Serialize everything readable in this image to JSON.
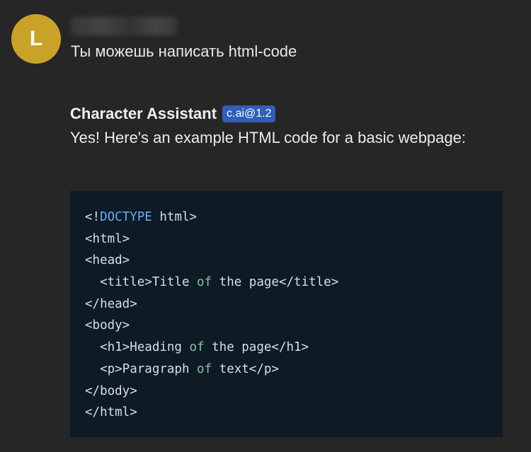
{
  "user_message": {
    "avatar_letter": "L",
    "text": "Ты можешь написать html-code"
  },
  "assistant_message": {
    "name": "Character Assistant",
    "badge": "c.ai@1.2",
    "text": "Yes! Here's an example HTML code for a basic webpage:"
  },
  "code_block": {
    "lines": [
      {
        "indent": "",
        "parts": [
          {
            "t": "<!",
            "c": "tag"
          },
          {
            "t": "DOCTYPE",
            "c": "kw"
          },
          {
            "t": " html>",
            "c": "tag"
          }
        ]
      },
      {
        "indent": "",
        "parts": [
          {
            "t": "<html>",
            "c": "tag"
          }
        ]
      },
      {
        "indent": "",
        "parts": [
          {
            "t": "<head>",
            "c": "tag"
          }
        ]
      },
      {
        "indent": "  ",
        "parts": [
          {
            "t": "<title>Title ",
            "c": "tag"
          },
          {
            "t": "of",
            "c": "word"
          },
          {
            "t": " the page</title>",
            "c": "tag"
          }
        ]
      },
      {
        "indent": "",
        "parts": [
          {
            "t": "</head>",
            "c": "tag"
          }
        ]
      },
      {
        "indent": "",
        "parts": [
          {
            "t": "<body>",
            "c": "tag"
          }
        ]
      },
      {
        "indent": "  ",
        "parts": [
          {
            "t": "<h1>Heading ",
            "c": "tag"
          },
          {
            "t": "of",
            "c": "word"
          },
          {
            "t": " the page</h1>",
            "c": "tag"
          }
        ]
      },
      {
        "indent": "  ",
        "parts": [
          {
            "t": "<p>Paragraph ",
            "c": "tag"
          },
          {
            "t": "of",
            "c": "word"
          },
          {
            "t": " text</p>",
            "c": "tag"
          }
        ]
      },
      {
        "indent": "",
        "parts": [
          {
            "t": "</body>",
            "c": "tag"
          }
        ]
      },
      {
        "indent": "",
        "parts": [
          {
            "t": "</html>",
            "c": "tag"
          }
        ]
      }
    ]
  },
  "colors": {
    "background": "#262626",
    "avatar": "#c9a228",
    "badge": "#2f5fb8",
    "code_background": "#0e1b24",
    "code_keyword": "#6ea8fe",
    "code_word": "#7dc4a8"
  }
}
